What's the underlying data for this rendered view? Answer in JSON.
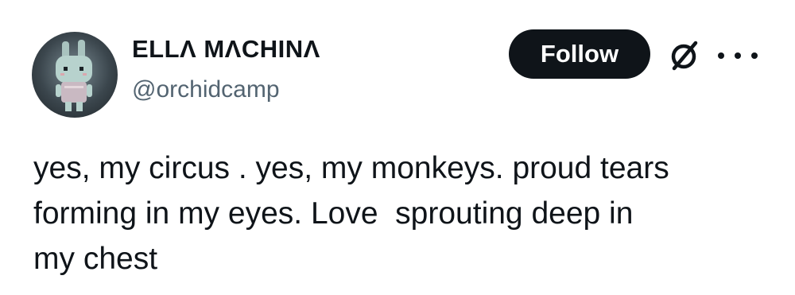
{
  "author": {
    "display_name": "ELLΛ MΛCHINΛ",
    "handle": "@orchidcamp",
    "avatar_icon": "pixel-bunny-avatar"
  },
  "actions": {
    "follow_label": "Follow",
    "grok_icon": "grok-slash-circle-icon",
    "more_icon": "more-horizontal-icon"
  },
  "tweet": {
    "text": "yes, my circus . yes, my monkeys. proud tears\nforming in my eyes. Love  sprouting deep in\nmy chest"
  },
  "colors": {
    "text_primary": "#0f1419",
    "text_secondary": "#536471",
    "button_bg": "#0f1419",
    "button_text": "#ffffff"
  }
}
